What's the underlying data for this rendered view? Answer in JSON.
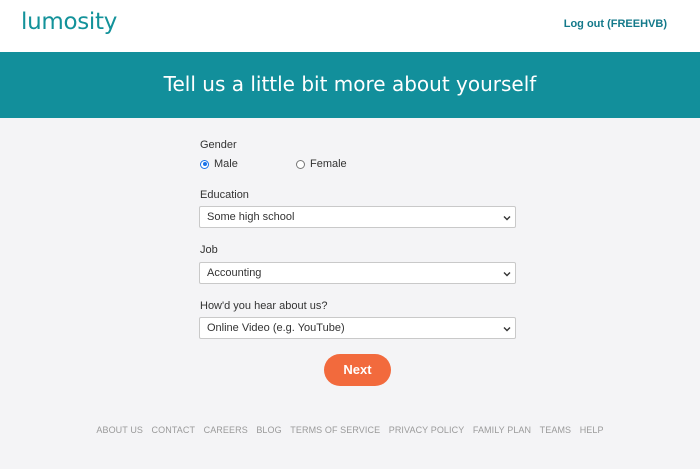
{
  "header": {
    "logo": "lumosity",
    "logout_label": "Log out (FREEHVB)"
  },
  "banner": {
    "title": "Tell us a little bit more about yourself"
  },
  "form": {
    "gender": {
      "label": "Gender",
      "options": [
        {
          "label": "Male",
          "checked": true
        },
        {
          "label": "Female",
          "checked": false
        }
      ]
    },
    "education": {
      "label": "Education",
      "value": "Some high school"
    },
    "job": {
      "label": "Job",
      "value": "Accounting"
    },
    "hear": {
      "label": "How'd you hear about us?",
      "value": "Online Video (e.g. YouTube)"
    },
    "next_label": "Next"
  },
  "footer": {
    "links": [
      "ABOUT US",
      "CONTACT",
      "CAREERS",
      "BLOG",
      "TERMS OF SERVICE",
      "PRIVACY POLICY",
      "FAMILY PLAN",
      "TEAMS",
      "HELP"
    ]
  },
  "colors": {
    "brand_teal": "#128f9b",
    "button_orange": "#f26a3d",
    "radio_blue": "#1a73e8"
  }
}
